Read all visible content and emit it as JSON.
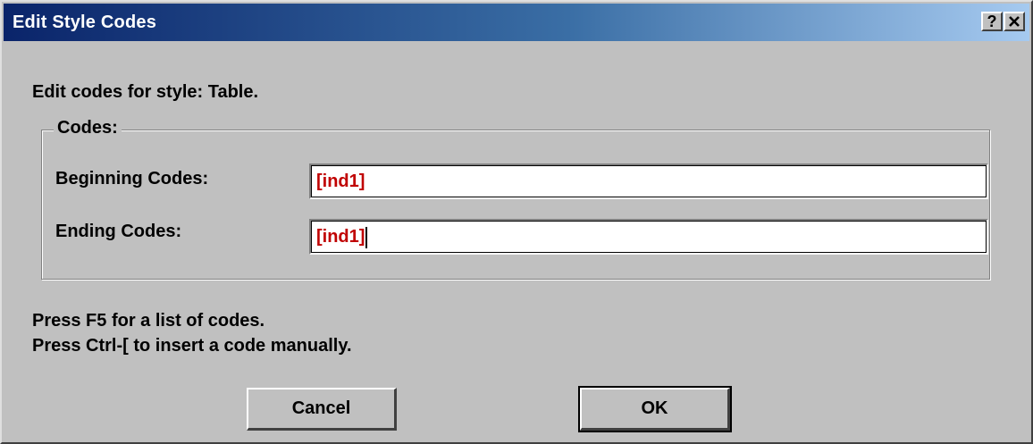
{
  "window": {
    "title": "Edit Style Codes",
    "help_glyph": "?",
    "close_icon": "close-x-icon"
  },
  "dialog": {
    "intro": "Edit codes for style: Table.",
    "group_label": "Codes:",
    "beginning_label": "Beginning Codes:",
    "beginning_value": "[ind1]",
    "ending_label": "Ending Codes:",
    "ending_value": "[ind1]",
    "hint_line1": "Press F5 for a list of codes.",
    "hint_line2": "Press Ctrl-[ to insert a code manually."
  },
  "buttons": {
    "cancel_label": "Cancel",
    "ok_label": "OK"
  },
  "colors": {
    "title_bar": "#0a246a",
    "dialog_bg": "#c0c0c0",
    "code_text": "#c00000"
  }
}
